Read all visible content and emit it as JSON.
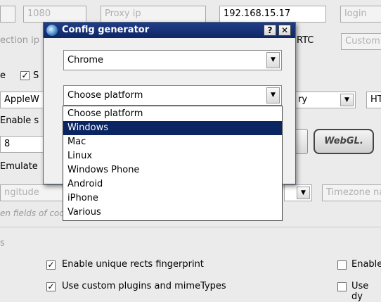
{
  "background": {
    "port_value": "1080",
    "proxy_ip_placeholder": "Proxy ip",
    "ip_value": "192.168.15.17",
    "login_placeholder": "login",
    "connection_ip_label": "ection ip",
    "webrtc_label": "RTC",
    "webrtc_select_value": "Custom",
    "left_label_e": "e",
    "left_check_s_label": "S",
    "apple_value": "AppleW",
    "country_label": "ry",
    "ht_value": "HT",
    "enable_s_label": "Enable s",
    "num_value": "8",
    "webgl_button": "WebGL.",
    "emulate_label": "Emulate",
    "longitude_placeholder": "ngitude",
    "timezone_placeholder": "Timezone na",
    "hint_text": "en fields of coo",
    "section_label": "s",
    "option_rects": "Enable unique rects fingerprint",
    "option_plugins": "Use custom plugins and mimeTypes",
    "option_right1": "Enable",
    "option_right2": "Use dy",
    "check_mark": "✓"
  },
  "dialog": {
    "title": "Config generator",
    "help_button": "?",
    "close_button": "✕",
    "browser_value": "Chrome",
    "platform_value": "Choose platform",
    "dropdown_arrow": "▼",
    "platform_options": [
      "Choose platform",
      "Windows",
      "Mac",
      "Linux",
      "Windows Phone",
      "Android",
      "iPhone",
      "Various"
    ],
    "selected_index": 1
  }
}
